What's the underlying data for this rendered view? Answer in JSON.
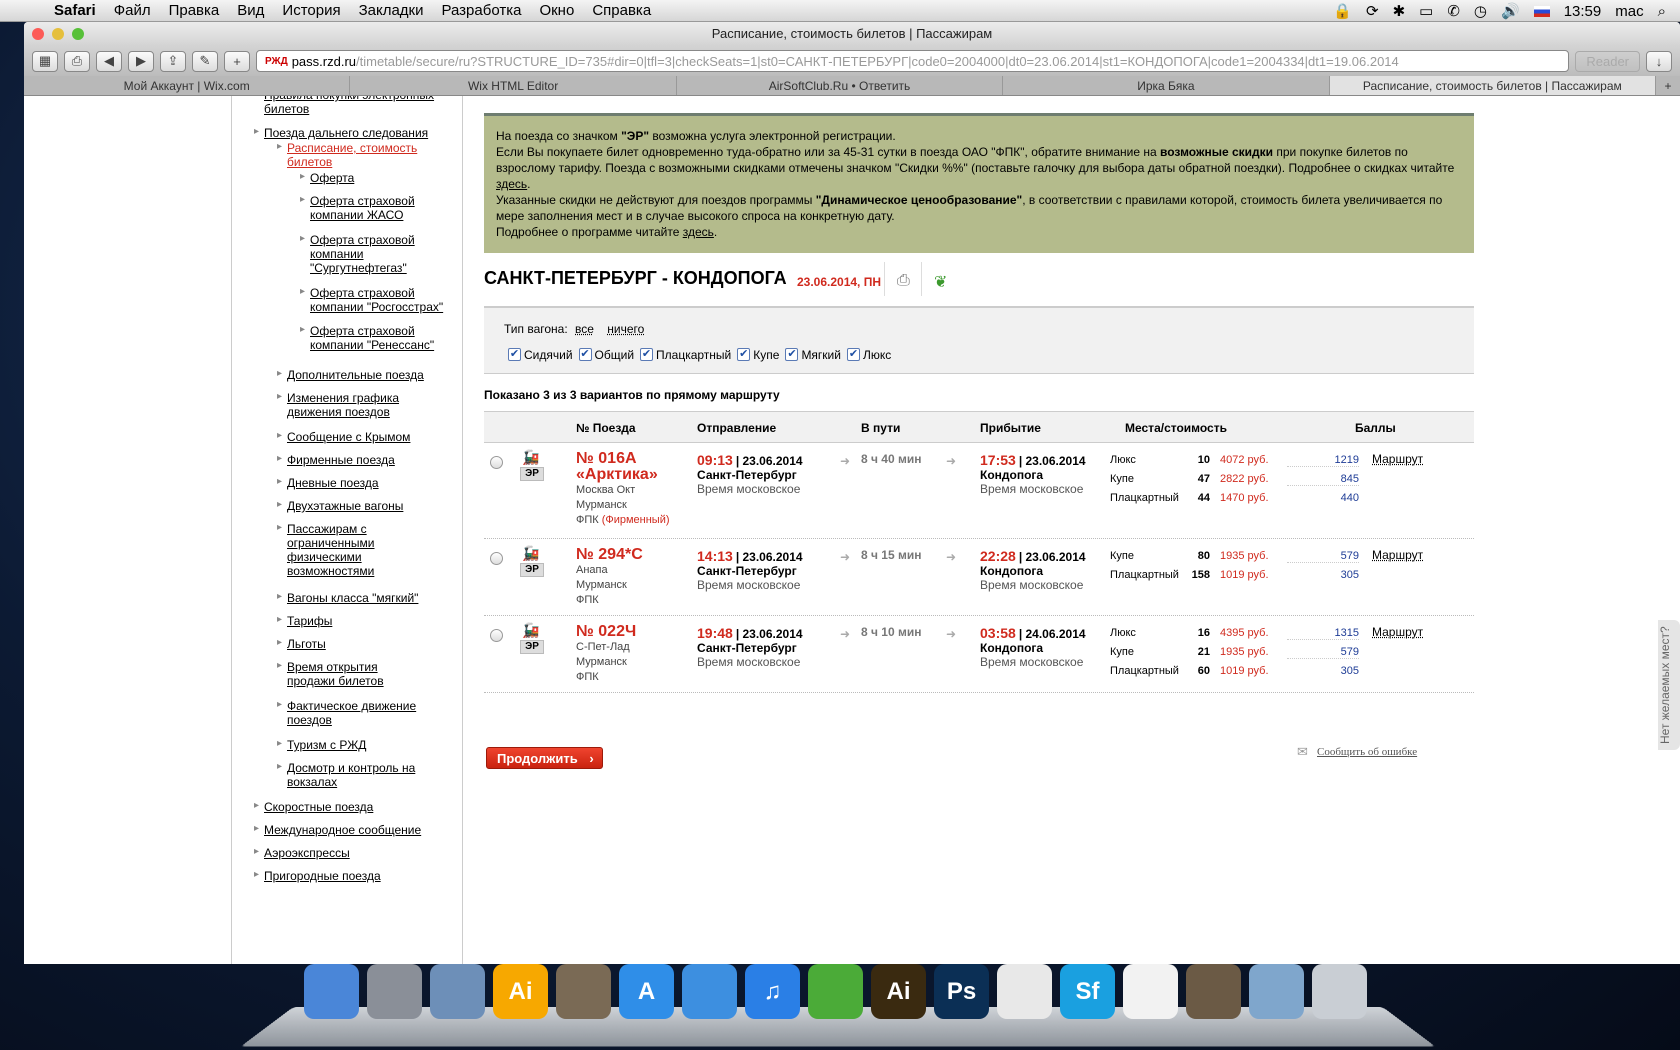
{
  "menubar": {
    "app": "Safari",
    "items": [
      "Файл",
      "Правка",
      "Вид",
      "История",
      "Закладки",
      "Разработка",
      "Окно",
      "Справка"
    ],
    "clock": "13:59",
    "user": "mac"
  },
  "window": {
    "title": "Расписание, стоимость билетов | Пассажирам",
    "url_host": "pass.rzd.ru",
    "url_rest": "/timetable/secure/ru?STRUCTURE_ID=735#dir=0|tfl=3|checkSeats=1|st0=САНКТ-ПЕТЕРБУРГ|code0=2004000|dt0=23.06.2014|st1=КОНДОПОГА|code1=2004334|dt1=19.06.2014",
    "reader": "Reader",
    "tabs": [
      "Мой Аккаунт | Wix.com",
      "Wix HTML Editor",
      "AirSoftClub.Ru • Ответить",
      "Ирка Бяка",
      "Расписание, стоимость билетов | Пассажирам"
    ]
  },
  "sidebar": {
    "top": "Правила покупки электронных билетов",
    "long": "Поезда дальнего следования",
    "active": "Расписание, стоимость билетов",
    "sub": [
      "Оферта",
      "Оферта страховой компании ЖАСО",
      "Оферта страховой компании \"Сургутнефтегаз\"",
      "Оферта страховой компании \"Росгосстрах\"",
      "Оферта страховой компании \"Ренессанс\""
    ],
    "items": [
      "Дополнительные поезда",
      "Изменения графика движения поездов",
      "Сообщение с Крымом",
      "Фирменные поезда",
      "Дневные поезда",
      "Двухэтажные вагоны",
      "Пассажирам с ограниченными физическими возможностями",
      "Вагоны класса \"мягкий\"",
      "Тарифы",
      "Льготы",
      "Время открытия продажи билетов",
      "Фактическое движение поездов",
      "Туризм с РЖД",
      "Досмотр и контроль на вокзалах"
    ],
    "bottom": [
      "Скоростные поезда",
      "Международное сообщение",
      "Аэроэкспрессы",
      "Пригородные поезда"
    ]
  },
  "notice": {
    "l1a": "На поезда со значком ",
    "l1b": "\"ЭР\"",
    "l1c": " возможна услуга электронной регистрации.",
    "l2a": "Если Вы покупаете билет одновременно туда-обратно или за 45-31 сутки в поезда ОАО \"ФПК\", обратите внимание на ",
    "l2b": "возможные скидки",
    "l2c": " при покупке билетов по взрослому тарифу. Поезда с возможными скидками отмечены значком \"Скидки %%\" (поставьте галочку для выбора даты обратной поездки). Подробнее о скидках читайте ",
    "l2d": "здесь",
    "l3a": "Указанные скидки не действуют для поездов программы ",
    "l3b": "\"Динамическое ценообразование\"",
    "l3c": ", в соответствии с правилами которой, стоимость билета увеличивается по мере заполнения мест и в случае высокого спроса на конкретную дату.",
    "l4a": "Подробнее о программе читайте ",
    "l4b": "здесь"
  },
  "route": {
    "title": "САНКТ-ПЕТЕРБУРГ - КОНДОПОГА",
    "date": "23.06.2014, ПН"
  },
  "filter": {
    "label": "Тип вагона:",
    "all": "все",
    "none": "ничего",
    "types": [
      "Сидячий",
      "Общий",
      "Плацкартный",
      "Купе",
      "Мягкий",
      "Люкс"
    ]
  },
  "shown": "Показано 3 из 3 вариантов по прямому маршруту",
  "headers": {
    "train": "№ Поезда",
    "dep": "Отправление",
    "dur": "В пути",
    "arr": "Прибытие",
    "seats": "Места/стоимость",
    "points": "Баллы"
  },
  "trains": [
    {
      "num": "№ 016А",
      "name": "«Арктика»",
      "from": "Москва Окт",
      "to": "Мурманск",
      "carrier": "ФПК",
      "brand": "(Фирменный)",
      "dep_time": "09:13",
      "dep_date": "| 23.06.2014",
      "dep_st": "Санкт-Петербург",
      "tz": "Время московское",
      "dur": "8 ч 40 мин",
      "arr_time": "17:53",
      "arr_date": "| 23.06.2014",
      "arr_st": "Кондопога",
      "er": "ЭР",
      "route": "Маршрут",
      "seats": [
        {
          "cls": "Люкс",
          "cnt": "10",
          "price": "4072 руб.",
          "pts": "1219"
        },
        {
          "cls": "Купе",
          "cnt": "47",
          "price": "2822 руб.",
          "pts": "845"
        },
        {
          "cls": "Плацкартный",
          "cnt": "44",
          "price": "1470 руб.",
          "pts": "440"
        }
      ]
    },
    {
      "num": "№ 294*С",
      "name": "",
      "from": "Анапа",
      "to": "Мурманск",
      "carrier": "ФПК",
      "brand": "",
      "dep_time": "14:13",
      "dep_date": "| 23.06.2014",
      "dep_st": "Санкт-Петербург",
      "tz": "Время московское",
      "dur": "8 ч 15 мин",
      "arr_time": "22:28",
      "arr_date": "| 23.06.2014",
      "arr_st": "Кондопога",
      "er": "ЭР",
      "route": "Маршрут",
      "seats": [
        {
          "cls": "Купе",
          "cnt": "80",
          "price": "1935 руб.",
          "pts": "579"
        },
        {
          "cls": "Плацкартный",
          "cnt": "158",
          "price": "1019 руб.",
          "pts": "305"
        }
      ]
    },
    {
      "num": "№ 022Ч",
      "name": "",
      "from": "С-Пет-Лад",
      "to": "Мурманск",
      "carrier": "ФПК",
      "brand": "",
      "dep_time": "19:48",
      "dep_date": "| 23.06.2014",
      "dep_st": "Санкт-Петербург",
      "tz": "Время московское",
      "dur": "8 ч 10 мин",
      "arr_time": "03:58",
      "arr_date": "| 24.06.2014",
      "arr_st": "Кондопога",
      "er": "ЭР",
      "route": "Маршрут",
      "seats": [
        {
          "cls": "Люкс",
          "cnt": "16",
          "price": "4395 руб.",
          "pts": "1315"
        },
        {
          "cls": "Купе",
          "cnt": "21",
          "price": "1935 руб.",
          "pts": "579"
        },
        {
          "cls": "Плацкартный",
          "cnt": "60",
          "price": "1019 руб.",
          "pts": "305"
        }
      ]
    }
  ],
  "continue": "Продолжить",
  "report": "Сообщить об ошибке",
  "sidetab": "Нет желаемых мест?",
  "dock": [
    {
      "icon": "finder-icon",
      "text": "",
      "color": "#4a86d8"
    },
    {
      "icon": "launchpad-icon",
      "text": "",
      "color": "#8a8f98"
    },
    {
      "icon": "mail-icon",
      "text": "",
      "color": "#6d8fb8"
    },
    {
      "icon": "illustrator-icon",
      "text": "Ai",
      "color": "#f7a800"
    },
    {
      "icon": "preview-icon",
      "text": "",
      "color": "#7a6a55"
    },
    {
      "icon": "appstore-icon",
      "text": "A",
      "color": "#2f8ee8"
    },
    {
      "icon": "safari-icon",
      "text": "",
      "color": "#3d8fe0"
    },
    {
      "icon": "itunes-icon",
      "text": "♫",
      "color": "#2a7fe6"
    },
    {
      "icon": "adium-icon",
      "text": "",
      "color": "#4bab38"
    },
    {
      "icon": "illustrator2-icon",
      "text": "Ai",
      "color": "#3a2a10"
    },
    {
      "icon": "photoshop-icon",
      "text": "Ps",
      "color": "#0b2f55"
    },
    {
      "icon": "acrobat-icon",
      "text": "",
      "color": "#e8e8e8"
    },
    {
      "icon": "sf-icon",
      "text": "Sf",
      "color": "#1aa0e0"
    },
    {
      "icon": "textedit-icon",
      "text": "",
      "color": "#f2f2f2"
    },
    {
      "icon": "app-icon",
      "text": "",
      "color": "#6b5a45"
    },
    {
      "icon": "downloads-icon",
      "text": "",
      "color": "#7fa6cc"
    },
    {
      "icon": "trash-icon",
      "text": "",
      "color": "#c9ced4"
    }
  ]
}
